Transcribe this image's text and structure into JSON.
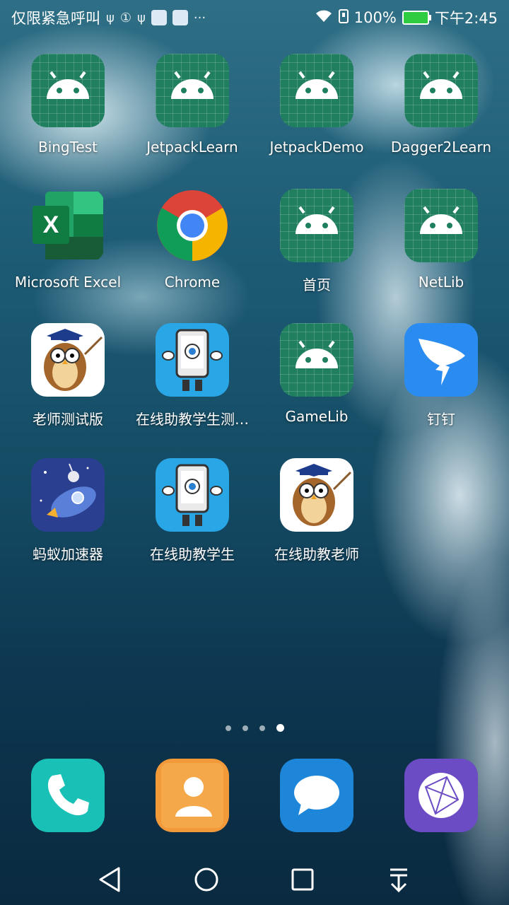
{
  "status_bar": {
    "left_text": "仅限紧急呼叫",
    "battery_percent": "100%",
    "time": "下午2:45",
    "icons": [
      "usb-icon",
      "sim-icon",
      "usb-icon",
      "app-notification-icon",
      "baidu-icon",
      "more-icon",
      "wifi-icon",
      "sim-card-icon",
      "battery-icon"
    ]
  },
  "apps": [
    {
      "label": "BingTest",
      "icon": "android-icon"
    },
    {
      "label": "JetpackLearn",
      "icon": "android-icon"
    },
    {
      "label": "JetpackDemo",
      "icon": "android-icon"
    },
    {
      "label": "Dagger2Learn",
      "icon": "android-icon"
    },
    {
      "label": "Microsoft Excel",
      "icon": "excel-icon"
    },
    {
      "label": "Chrome",
      "icon": "chrome-icon"
    },
    {
      "label": "首页",
      "icon": "android-icon"
    },
    {
      "label": "NetLib",
      "icon": "android-icon"
    },
    {
      "label": "老师测试版",
      "icon": "owl-teacher-icon"
    },
    {
      "label": "在线助教学生测…",
      "icon": "tablet-character-icon"
    },
    {
      "label": "GameLib",
      "icon": "android-icon"
    },
    {
      "label": "钉钉",
      "icon": "dingtalk-icon"
    },
    {
      "label": "蚂蚁加速器",
      "icon": "rocket-ant-icon"
    },
    {
      "label": "在线助教学生",
      "icon": "tablet-character-icon"
    },
    {
      "label": "在线助教老师",
      "icon": "owl-teacher-icon"
    }
  ],
  "page_indicator": {
    "pages": 4,
    "current": 4
  },
  "dock": [
    {
      "icon": "phone-icon"
    },
    {
      "icon": "contacts-icon"
    },
    {
      "icon": "messages-icon"
    },
    {
      "icon": "browser-icon"
    }
  ],
  "nav": [
    "back-icon",
    "home-icon",
    "recents-icon",
    "notification-pull-icon"
  ]
}
